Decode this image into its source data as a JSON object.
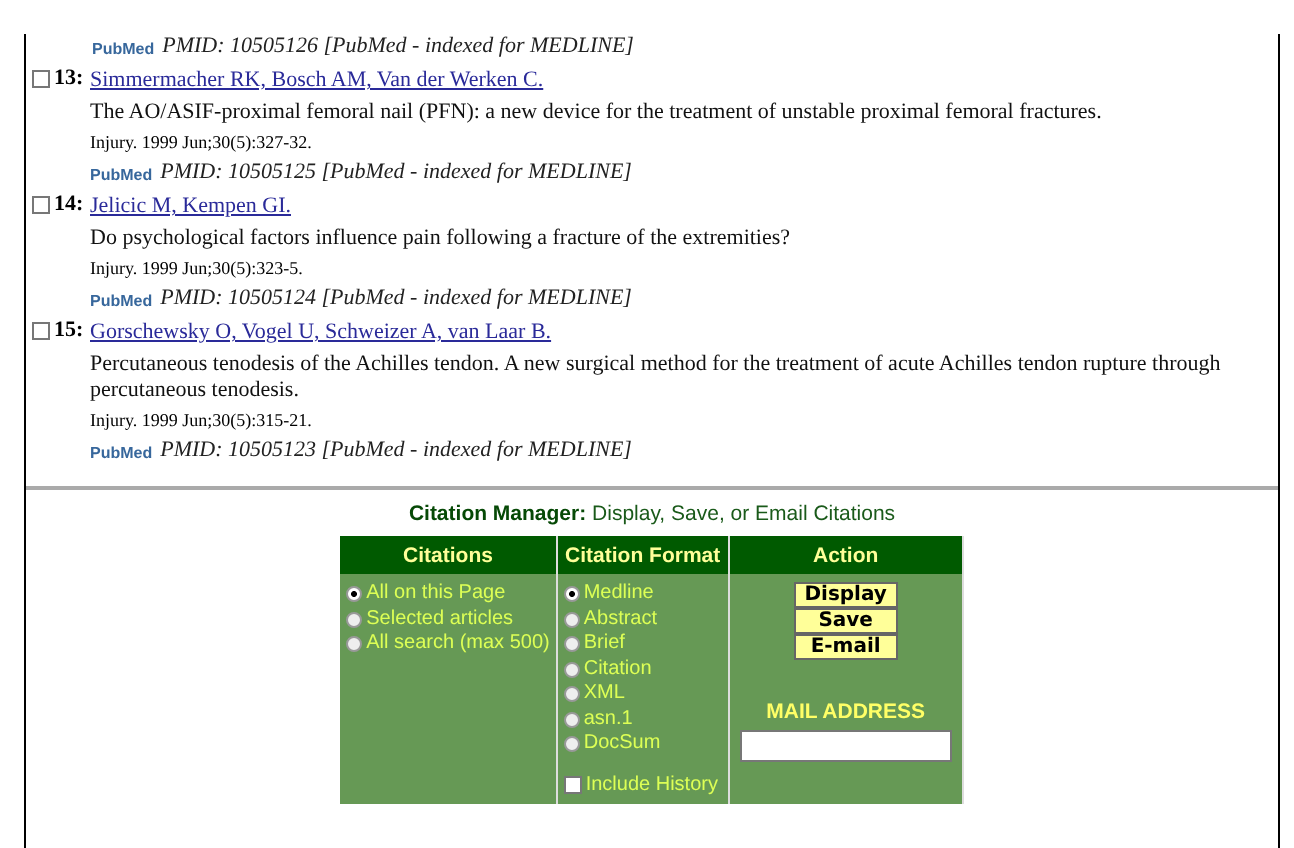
{
  "top_item": {
    "logo": "PubMed",
    "pmid": "PMID: 10505126 [PubMed - indexed for MEDLINE]"
  },
  "items": [
    {
      "checked": false,
      "number": "13:",
      "authors": "Simmermacher RK, Bosch AM, Van der Werken C.",
      "title": "The AO/ASIF-proximal femoral nail (PFN): a new device for the treatment of unstable proximal femoral fractures.",
      "source": "Injury. 1999 Jun;30(5):327-32.",
      "logo": "PubMed",
      "pmid": "PMID: 10505125 [PubMed - indexed for MEDLINE]"
    },
    {
      "checked": false,
      "number": "14:",
      "authors": "Jelicic M, Kempen GI.",
      "title": "Do psychological factors influence pain following a fracture of the extremities?",
      "source": "Injury. 1999 Jun;30(5):323-5.",
      "logo": "PubMed",
      "pmid": "PMID: 10505124 [PubMed - indexed for MEDLINE]"
    },
    {
      "checked": false,
      "number": "15:",
      "authors": "Gorschewsky O, Vogel U, Schweizer A, van Laar B.",
      "title": "Percutaneous tenodesis of the Achilles tendon. A new surgical method for the treatment of acute Achilles tendon rupture through percutaneous tenodesis.",
      "source": "Injury. 1999 Jun;30(5):315-21.",
      "logo": "PubMed",
      "pmid": "PMID: 10505123 [PubMed - indexed for MEDLINE]"
    }
  ],
  "citation_manager": {
    "title": "Citation Manager:",
    "subtitle": "Display, Save, or Email Citations",
    "columns": [
      "Citations",
      "Citation Format",
      "Action"
    ],
    "citations": [
      {
        "label": "All on this Page",
        "selected": true
      },
      {
        "label": "Selected articles",
        "selected": false
      },
      {
        "label": "All search (max 500)",
        "selected": false
      }
    ],
    "formats": [
      {
        "label": "Medline",
        "selected": true
      },
      {
        "label": "Abstract",
        "selected": false
      },
      {
        "label": "Brief",
        "selected": false
      },
      {
        "label": "Citation",
        "selected": false
      },
      {
        "label": "XML",
        "selected": false
      },
      {
        "label": "asn.1",
        "selected": false
      },
      {
        "label": "DocSum",
        "selected": false
      }
    ],
    "include_history": {
      "label": "Include History",
      "checked": false
    },
    "buttons": [
      "Display",
      "Save",
      "E-mail"
    ],
    "mail_label": "MAIL ADDRESS"
  }
}
